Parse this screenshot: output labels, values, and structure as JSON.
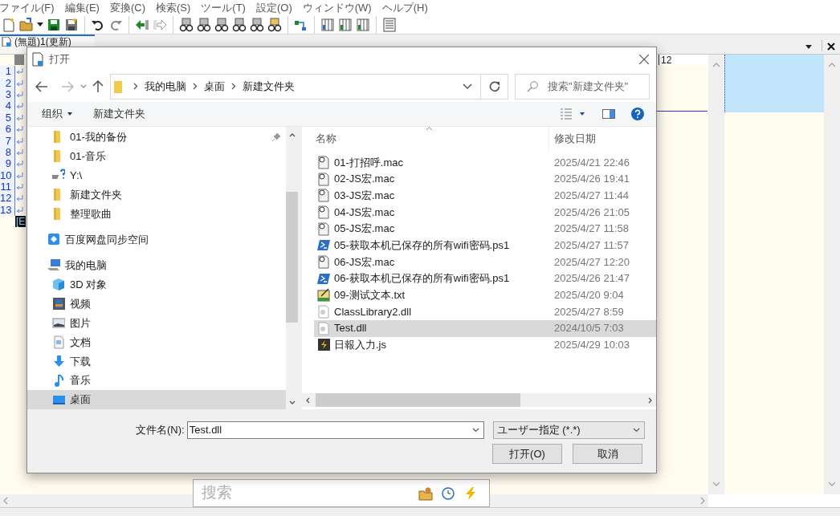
{
  "menu": [
    "ファイル(F)",
    "編集(E)",
    "変換(C)",
    "検索(S)",
    "ツール(T)",
    "設定(O)",
    "ウィンドウ(W)",
    "ヘルプ(H)"
  ],
  "editor": {
    "tab": "(無題)1(更新)",
    "line_numbers": [
      "1",
      "2",
      "3",
      "4",
      "5",
      "6",
      "7",
      "8",
      "9",
      "10",
      "11",
      "12",
      "13"
    ],
    "eof_marker": "[E",
    "ruler_label": "12"
  },
  "dialog": {
    "title": "打开",
    "breadcrumb": [
      "我的电脑",
      "桌面",
      "新建文件夹"
    ],
    "search": {
      "placeholder": "搜索\"新建文件夹\""
    },
    "toolbar": {
      "organize": "组织",
      "new_folder": "新建文件夹"
    },
    "quick_access": [
      {
        "label": "01-我的备份",
        "kind": "folder",
        "pinned": true,
        "selected": false
      },
      {
        "label": "01-音乐",
        "kind": "folder",
        "pinned": false,
        "selected": false
      },
      {
        "label": "Y:\\",
        "kind": "drive",
        "pinned": false,
        "selected": false
      },
      {
        "label": "新建文件夹",
        "kind": "folder",
        "pinned": false,
        "selected": false
      },
      {
        "label": "整理歌曲",
        "kind": "folder",
        "pinned": false,
        "selected": false
      }
    ],
    "nav": [
      {
        "label": "百度网盘同步空间",
        "kind": "cloud",
        "selected": false
      },
      {
        "label": "我的电脑",
        "kind": "computer",
        "selected": false,
        "children": [
          {
            "label": "3D 对象",
            "kind": "cube",
            "selected": false
          },
          {
            "label": "视频",
            "kind": "video",
            "selected": false
          },
          {
            "label": "图片",
            "kind": "picture",
            "selected": false
          },
          {
            "label": "文档",
            "kind": "document",
            "selected": false
          },
          {
            "label": "下载",
            "kind": "download",
            "selected": false
          },
          {
            "label": "音乐",
            "kind": "music",
            "selected": false
          },
          {
            "label": "桌面",
            "kind": "desktop",
            "selected": true
          }
        ]
      }
    ],
    "columns": [
      "名称",
      "修改日期"
    ],
    "files": [
      {
        "name": "01-打招呼.mac",
        "modified": "2025/4/21 22:46",
        "kind": "macro",
        "selected": false
      },
      {
        "name": "02-JS宏.mac",
        "modified": "2025/4/26 19:41",
        "kind": "macro",
        "selected": false
      },
      {
        "name": "03-JS宏.mac",
        "modified": "2025/4/27 11:44",
        "kind": "macro",
        "selected": false
      },
      {
        "name": "04-JS宏.mac",
        "modified": "2025/4/26 21:05",
        "kind": "macro",
        "selected": false
      },
      {
        "name": "05-JS宏.mac",
        "modified": "2025/4/27 11:58",
        "kind": "macro",
        "selected": false
      },
      {
        "name": "05-获取本机已保存的所有wifi密码.ps1",
        "modified": "2025/4/27 11:57",
        "kind": "powershell",
        "selected": false
      },
      {
        "name": "06-JS宏.mac",
        "modified": "2025/4/27 12:20",
        "kind": "macro",
        "selected": false
      },
      {
        "name": "06-获取本机已保存的所有wifi密码.ps1",
        "modified": "2025/4/26 21:47",
        "kind": "powershell",
        "selected": false
      },
      {
        "name": "09-测试文本.txt",
        "modified": "2025/4/20 9:04",
        "kind": "text",
        "selected": false
      },
      {
        "name": "ClassLibrary2.dll",
        "modified": "2025/4/27 8:59",
        "kind": "library",
        "selected": false
      },
      {
        "name": "Test.dll",
        "modified": "2024/10/5 7:03",
        "kind": "library",
        "selected": true
      },
      {
        "name": "日報入力.js",
        "modified": "2025/4/29 10:03",
        "kind": "script",
        "selected": false
      }
    ],
    "filename_label": "文件名(N):",
    "filename": "Test.dll",
    "filter": "ユーザー指定 (*.*)",
    "buttons": [
      "打开(O)",
      "取消"
    ]
  },
  "search_box": {
    "placeholder": "搜索"
  }
}
